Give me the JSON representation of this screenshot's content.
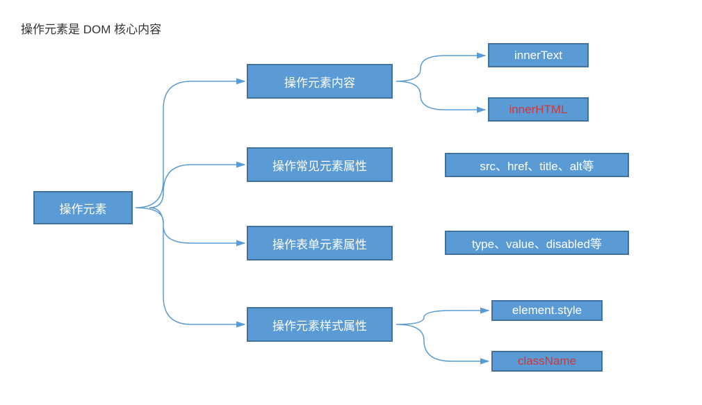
{
  "title": "操作元素是 DOM 核心内容",
  "root": {
    "label": "操作元素"
  },
  "branches": [
    {
      "label": "操作元素内容",
      "leaves": [
        {
          "label": "innerText",
          "red": false
        },
        {
          "label": "innerHTML",
          "red": true
        }
      ]
    },
    {
      "label": "操作常见元素属性",
      "leaves": [
        {
          "label": "src、href、title、alt等",
          "red": false
        }
      ]
    },
    {
      "label": "操作表单元素属性",
      "leaves": [
        {
          "label": "type、value、disabled等",
          "red": false
        }
      ]
    },
    {
      "label": "操作元素样式属性",
      "leaves": [
        {
          "label": "element.style",
          "red": false
        },
        {
          "label": "className",
          "red": true
        }
      ]
    }
  ]
}
